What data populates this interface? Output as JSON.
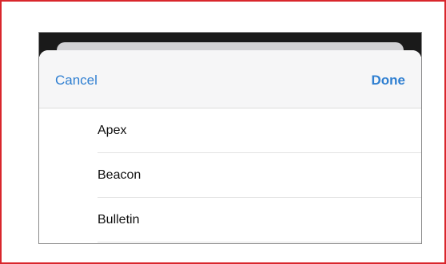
{
  "sheet": {
    "cancel_label": "Cancel",
    "done_label": "Done"
  },
  "list": {
    "items": [
      {
        "label": "Apex"
      },
      {
        "label": "Beacon"
      },
      {
        "label": "Bulletin"
      }
    ]
  },
  "colors": {
    "accent": "#2f7fd1",
    "frame_border": "#d9262c",
    "nav_background": "#f6f6f7",
    "separator": "#e2e2e2"
  }
}
